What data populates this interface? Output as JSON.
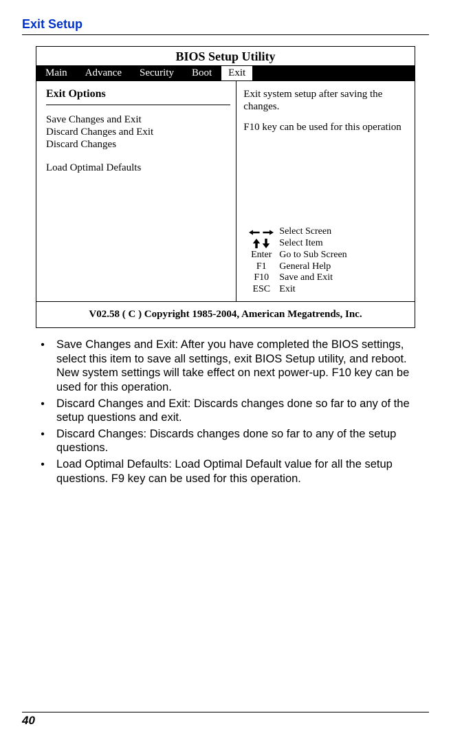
{
  "section_title": "Exit Setup",
  "bios": {
    "title": "BIOS Setup Utility",
    "tabs": [
      "Main",
      "Advance",
      "Security",
      "Boot",
      "Exit"
    ],
    "active_tab": "Exit",
    "left": {
      "heading": "Exit Options",
      "items": [
        "Save Changes and Exit",
        "Discard Changes and Exit",
        "Discard Changes",
        "",
        "Load Optimal Defaults"
      ]
    },
    "right": {
      "desc1": "Exit system setup after saving the changes.",
      "desc2": "F10 key can be used for this operation",
      "keys": [
        {
          "k": "←→",
          "label": "Select Screen"
        },
        {
          "k": "↑↓",
          "label": "Select Item"
        },
        {
          "k": "Enter",
          "label": "Go to Sub Screen"
        },
        {
          "k": "F1",
          "label": "General Help"
        },
        {
          "k": "F10",
          "label": "Save and Exit"
        },
        {
          "k": "ESC",
          "label": "Exit"
        }
      ]
    },
    "footer": "V02.58   ( C ) Copyright 1985-2004, American Megatrends, Inc."
  },
  "bullets": [
    "Save Changes and Exit: After you have completed the BIOS settings, select this item to save all settings, exit BIOS Setup utility, and reboot. New system settings will take effect on next power-up. F10 key can be used for this operation.",
    "Discard Changes and Exit: Discards changes done so far to any of the setup questions and exit.",
    "Discard Changes: Discards changes done so far to any of the setup questions.",
    "Load Optimal Defaults: Load Optimal Default value for all the setup questions. F9 key can be used for this operation."
  ],
  "page_number": "40"
}
